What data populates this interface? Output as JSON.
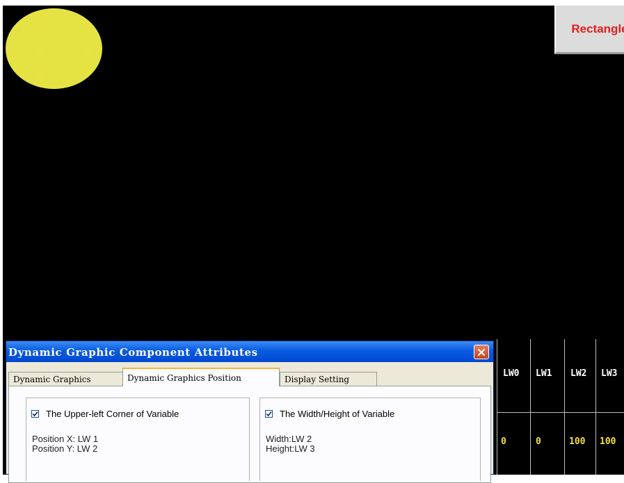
{
  "canvas": {
    "button_label": "Rectangle",
    "circle_color": "#e3e033",
    "table": {
      "headers": [
        "LW0",
        "LW1",
        "LW2",
        "LW3"
      ],
      "values": [
        "0",
        "0",
        "100",
        "100"
      ]
    }
  },
  "dialog": {
    "title": "Dynamic Graphic Component Attributes",
    "close_icon": "close-icon",
    "tabs": [
      {
        "label": "Dynamic Graphics"
      },
      {
        "label": "Dynamic Graphics Position"
      },
      {
        "label": "Display Setting"
      }
    ],
    "active_tab": "Dynamic Graphics Position",
    "left_group": {
      "checkbox_label": "The Upper-left Corner of Variable",
      "checked": true,
      "line1": "Position X: LW 1",
      "line2": "Position Y: LW 2"
    },
    "right_group": {
      "checkbox_label": "The Width/Height of Variable",
      "checked": true,
      "line1": "Width:LW 2",
      "line2": "Height:LW 3"
    }
  }
}
